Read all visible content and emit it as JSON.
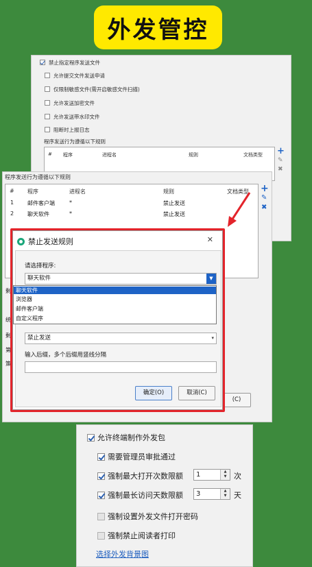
{
  "title": "外发管控",
  "panel_top": {
    "options": [
      {
        "label": "禁止指定程序发送文件",
        "checked": true
      },
      {
        "label": "允许提交文件发送申请",
        "checked": false
      },
      {
        "label": "仅限制敏感文件(需开启敏感文件扫描)",
        "checked": false
      },
      {
        "label": "允许发送加密文件",
        "checked": false
      },
      {
        "label": "允许发送带水印文件",
        "checked": false
      },
      {
        "label": "阻断时上报日志",
        "checked": false
      }
    ],
    "rule_caption": "程序发送行为遵循以下规则",
    "columns": [
      "#",
      "程序",
      "进程名",
      "规则",
      "文档类型"
    ]
  },
  "panel_mid": {
    "caption": "程序发送行为遵循以下规则",
    "columns": [
      "#",
      "程序",
      "进程名",
      "规则",
      "文档类型"
    ],
    "rows": [
      {
        "num": "1",
        "program": "邮件客户端",
        "process": "*",
        "rule": "禁止发送"
      },
      {
        "num": "2",
        "program": "聊天软件",
        "process": "*",
        "rule": "禁止发送"
      }
    ],
    "partial_labels": [
      "剩",
      "统",
      "剩",
      "第",
      "策"
    ],
    "bg_button": "(C)"
  },
  "dialog": {
    "title": "禁止发送规则",
    "select_program_label": "请选择程序:",
    "selected_program": "聊天软件",
    "options": [
      "聊天软件",
      "浏览器",
      "邮件客户端",
      "自定义程序"
    ],
    "rule_value": "禁止发送",
    "suffix_hint": "输入后缀，多个后缀用竖线分隔",
    "ok": "确定(O)",
    "cancel": "取消(C)"
  },
  "panel_bottom": {
    "options": [
      {
        "label": "允许终端制作外发包",
        "checked": true,
        "enabled": true
      },
      {
        "label": "需要管理员审批通过",
        "checked": true,
        "enabled": true
      },
      {
        "label": "强制最大打开次数限额",
        "checked": true,
        "enabled": true,
        "value": "1",
        "unit": "次"
      },
      {
        "label": "强制最长访问天数限额",
        "checked": true,
        "enabled": true,
        "value": "3",
        "unit": "天"
      },
      {
        "label": "强制设置外发文件打开密码",
        "checked": false,
        "enabled": false
      },
      {
        "label": "强制禁止阅读者打印",
        "checked": false,
        "enabled": false
      }
    ],
    "link": "选择外发背景图"
  },
  "colors": {
    "background": "#3d8a3d",
    "badge": "#ffe900",
    "accent": "#1e63c6",
    "highlight": "#e3242b"
  }
}
